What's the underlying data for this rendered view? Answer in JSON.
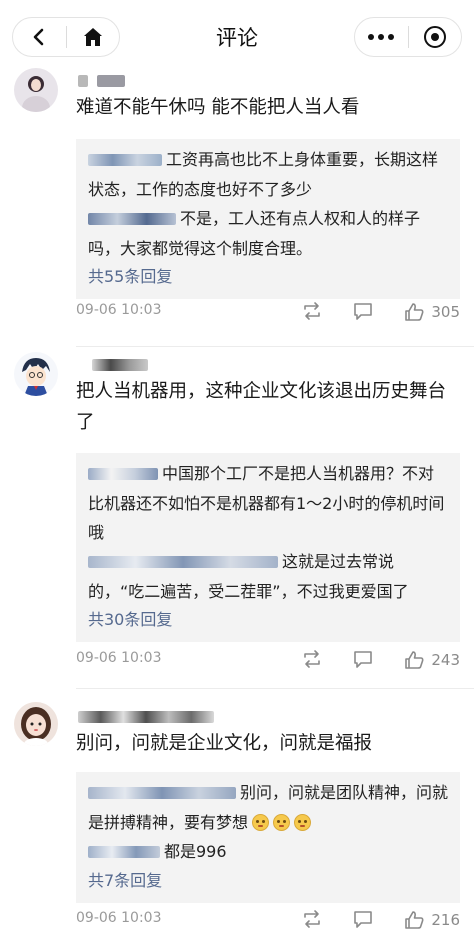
{
  "header": {
    "title": "评论",
    "back_icon": "chevron-left-icon",
    "home_icon": "home-icon",
    "more_icon": "more-dots-icon",
    "close_icon": "target-circle-icon"
  },
  "comments": [
    {
      "text": "难道不能午休吗 能不能把人当人看",
      "replies": [
        {
          "text": "工资再高也比不上身体重要，长期这样状态，工作的态度也好不了多少"
        },
        {
          "text": "不是，工人还有点人权和人的样子吗，大家都觉得这个制度合理。"
        }
      ],
      "more_replies": "共55条回复",
      "time": "09-06 10:03",
      "likes": "305"
    },
    {
      "text": "把人当机器用，这种企业文化该退出历史舞台了",
      "replies": [
        {
          "text": "中国那个工厂不是把人当机器用？不对比机器还不如怕不是机器都有1～2小时的停机时间哦"
        },
        {
          "text": "这就是过去常说的，“吃二遍苦，受二茬罪”，不过我更爱国了"
        }
      ],
      "more_replies": "共30条回复",
      "time": "09-06 10:03",
      "likes": "243"
    },
    {
      "text": "别问，问就是企业文化，问就是福报",
      "replies": [
        {
          "text": "别问，问就是团队精神，问就是拼搏精神，要有梦想"
        },
        {
          "text": "都是996"
        }
      ],
      "more_replies": "共7条回复",
      "time": "09-06 10:03",
      "likes": "216"
    }
  ],
  "colors": {
    "link": "#566a8f",
    "reply_bg": "#f3f3f3",
    "meta": "#9a9a9a"
  }
}
